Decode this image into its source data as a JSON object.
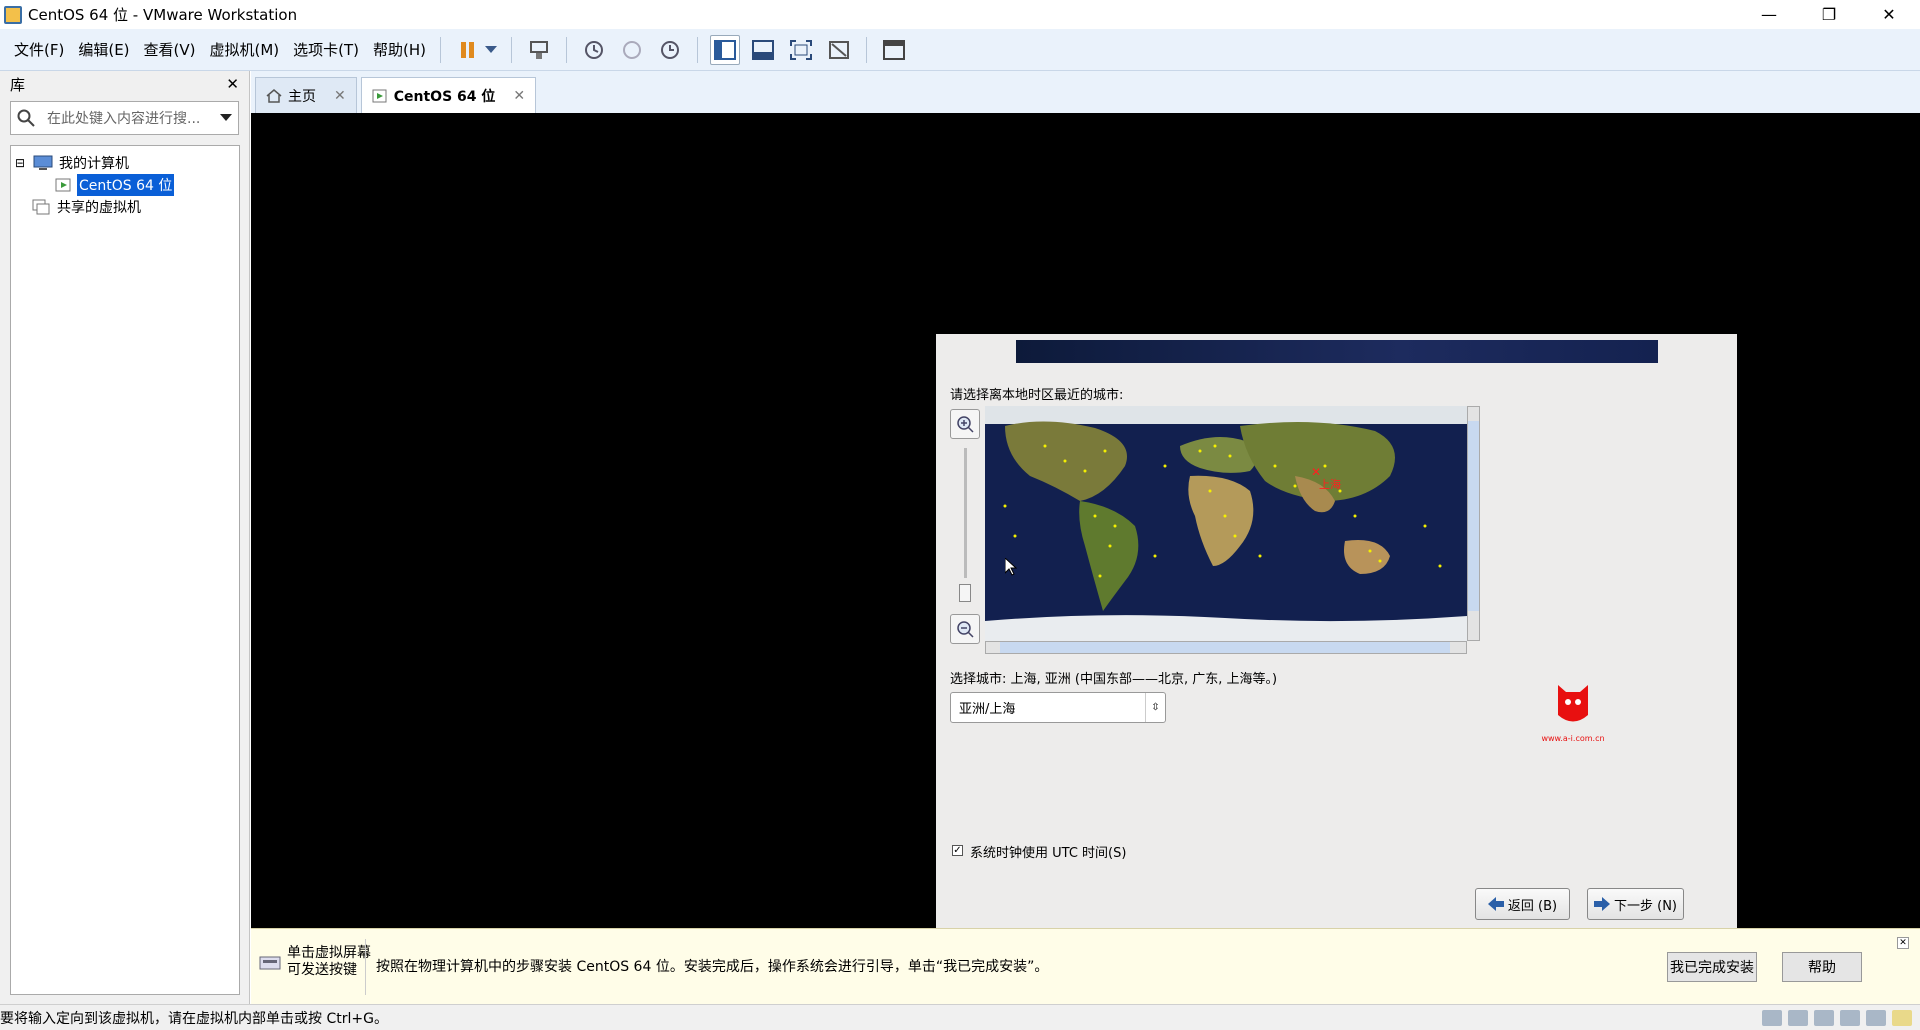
{
  "window": {
    "title": "CentOS 64 位 - VMware Workstation",
    "min": "—",
    "max": "❐",
    "close": "✕"
  },
  "menu": [
    "文件(F)",
    "编辑(E)",
    "查看(V)",
    "虚拟机(M)",
    "选项卡(T)",
    "帮助(H)"
  ],
  "library": {
    "title": "库",
    "close": "✕",
    "search_placeholder": "在此处键入内容进行搜...",
    "tree": [
      {
        "label": "我的计算机",
        "toggle": "⊟"
      },
      {
        "label": "CentOS 64 位"
      },
      {
        "label": "共享的虚拟机"
      }
    ]
  },
  "tabs": [
    {
      "label": "主页",
      "close": "✕"
    },
    {
      "label": "CentOS 64 位",
      "close": "✕"
    }
  ],
  "installer": {
    "prompt": "请选择离本地时区最近的城市:",
    "selected_city_label": "选择城市: 上海, 亚洲 (中国东部——北京, 广东, 上海等。)",
    "map_city": "上海",
    "timezone_value": "亚洲/上海",
    "utc_checkbox_label": "系统时钟使用 UTC 时间(S)",
    "utc_checked": true,
    "back_button": "返回 (B)",
    "next_button": "下一步 (N)"
  },
  "hint": {
    "icon_text_line1": "单击虚拟屏幕",
    "icon_text_line2": "可发送按键",
    "message": "按照在物理计算机中的步骤安装 CentOS 64 位。安装完成后，操作系统会进行引导，单击“我已完成安装”。",
    "done_button": "我已完成安装",
    "help_button": "帮助",
    "close": "✕"
  },
  "status_text": "要将输入定向到该虚拟机，请在虚拟机内部单击或按 Ctrl+G。",
  "watermark_text": "www.a-i.com.cn"
}
